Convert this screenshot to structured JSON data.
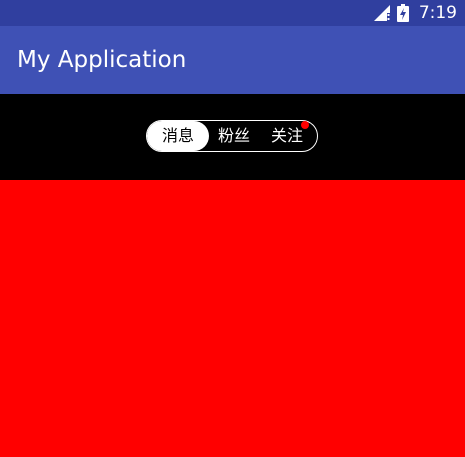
{
  "status_bar": {
    "time": "7:19",
    "icons": [
      "signal-icon",
      "battery-icon"
    ],
    "background": "#303f9f"
  },
  "app_bar": {
    "title": "My Application",
    "background": "#3f51b5"
  },
  "tabs": {
    "items": [
      {
        "label": "消息",
        "selected": true,
        "badge": false
      },
      {
        "label": "粉丝",
        "selected": false,
        "badge": false
      },
      {
        "label": "关注",
        "selected": false,
        "badge": true
      }
    ],
    "background": "#000000",
    "badge_color": "#ff0000"
  },
  "content": {
    "background": "#ff0000"
  }
}
